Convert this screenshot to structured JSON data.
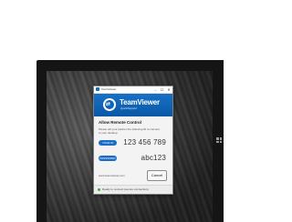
{
  "window": {
    "title": "TeamViewer",
    "controls": {
      "minimize": "–",
      "maximize": "☐",
      "close": "✕"
    }
  },
  "banner": {
    "brand": "TeamViewer",
    "subtitle": "QuickSupport"
  },
  "panel": {
    "heading": "Allow Remote Control",
    "description": "Please tell your partner the following ID to connect to your desktop."
  },
  "fields": {
    "id_label": "YOUR ID",
    "id_value": "123 456 789",
    "password_label": "PASSWORD",
    "password_value": "abc123"
  },
  "footer": {
    "link": "www.teamviewer.com",
    "cancel_label": "Cancel"
  },
  "status": {
    "text": "Ready to connect (secure connection)",
    "color": "#2db52d"
  },
  "colors": {
    "accent": "#0e6fbe",
    "pill": "#1a6cc4"
  },
  "icons": {
    "app": "teamviewer-icon",
    "logo": "teamviewer-logo-icon",
    "windows": "windows-logo-icon"
  }
}
